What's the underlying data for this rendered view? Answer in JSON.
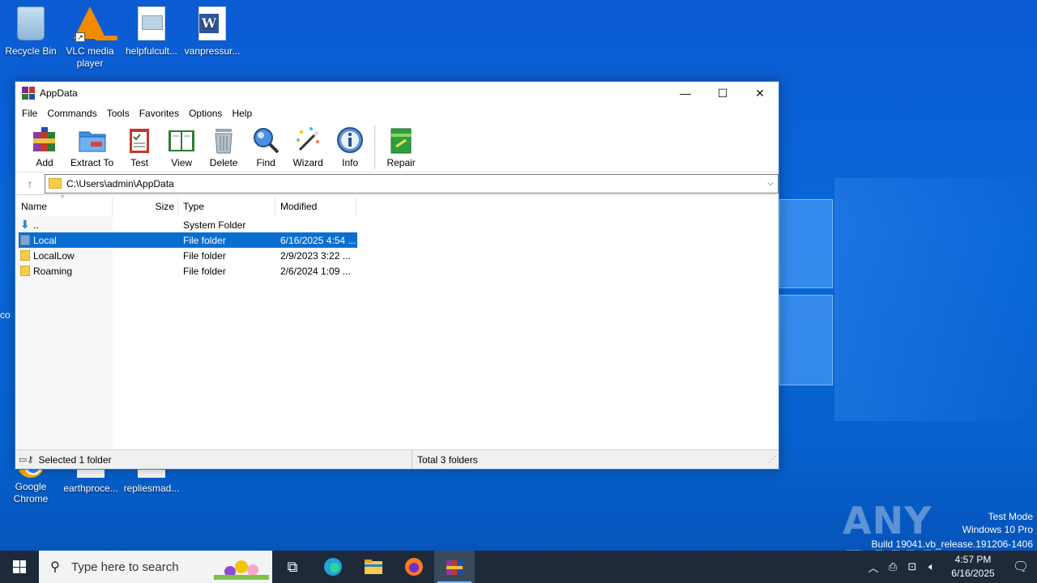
{
  "desktop": {
    "icons": [
      {
        "label": "Recycle Bin"
      },
      {
        "label": "VLC media player"
      },
      {
        "label": "helpfulcult..."
      },
      {
        "label": "vanpressur..."
      },
      {
        "label": "Google Chrome"
      },
      {
        "label": "earthproce..."
      },
      {
        "label": "repliesmad..."
      }
    ],
    "partial_labels": [
      "co"
    ]
  },
  "window": {
    "title": "AppData",
    "controls": {
      "minimize": "—",
      "maximize": "☐",
      "close": "✕"
    },
    "menu": [
      "File",
      "Commands",
      "Tools",
      "Favorites",
      "Options",
      "Help"
    ],
    "toolbar": [
      {
        "label": "Add",
        "icon": "add-archive-icon"
      },
      {
        "label": "Extract To",
        "icon": "extract-folder-icon"
      },
      {
        "label": "Test",
        "icon": "test-clipboard-icon"
      },
      {
        "label": "View",
        "icon": "view-book-icon"
      },
      {
        "label": "Delete",
        "icon": "trash-icon"
      },
      {
        "label": "Find",
        "icon": "magnifier-icon"
      },
      {
        "label": "Wizard",
        "icon": "wand-icon"
      },
      {
        "label": "Info",
        "icon": "info-icon"
      },
      {
        "label": "Repair",
        "icon": "repair-kit-icon"
      }
    ],
    "address": {
      "path": "C:\\Users\\admin\\AppData"
    },
    "columns": [
      "Name",
      "Size",
      "Type",
      "Modified"
    ],
    "rows": [
      {
        "name": "..",
        "size": "",
        "type": "System Folder",
        "modified": ""
      },
      {
        "name": "Local",
        "size": "",
        "type": "File folder",
        "modified": "6/16/2025 4:54 ...",
        "selected": true
      },
      {
        "name": "LocalLow",
        "size": "",
        "type": "File folder",
        "modified": "2/9/2023 3:22 ..."
      },
      {
        "name": "Roaming",
        "size": "",
        "type": "File folder",
        "modified": "2/6/2024 1:09 ..."
      }
    ],
    "status": {
      "left": "Selected 1 folder",
      "right": "Total 3 folders"
    }
  },
  "taskbar": {
    "search_placeholder": "Type here to search",
    "time": "4:57 PM",
    "date": "6/16/2025"
  },
  "watermark": {
    "brand": "ANY RUN",
    "line1": "Test Mode",
    "line2": "Windows 10 Pro",
    "line3": "Build 19041.vb_release.191206-1406"
  },
  "colors": {
    "selection": "#0a6ed1",
    "taskbar": "#1e2a3a",
    "desktop": "#0a67d8"
  }
}
